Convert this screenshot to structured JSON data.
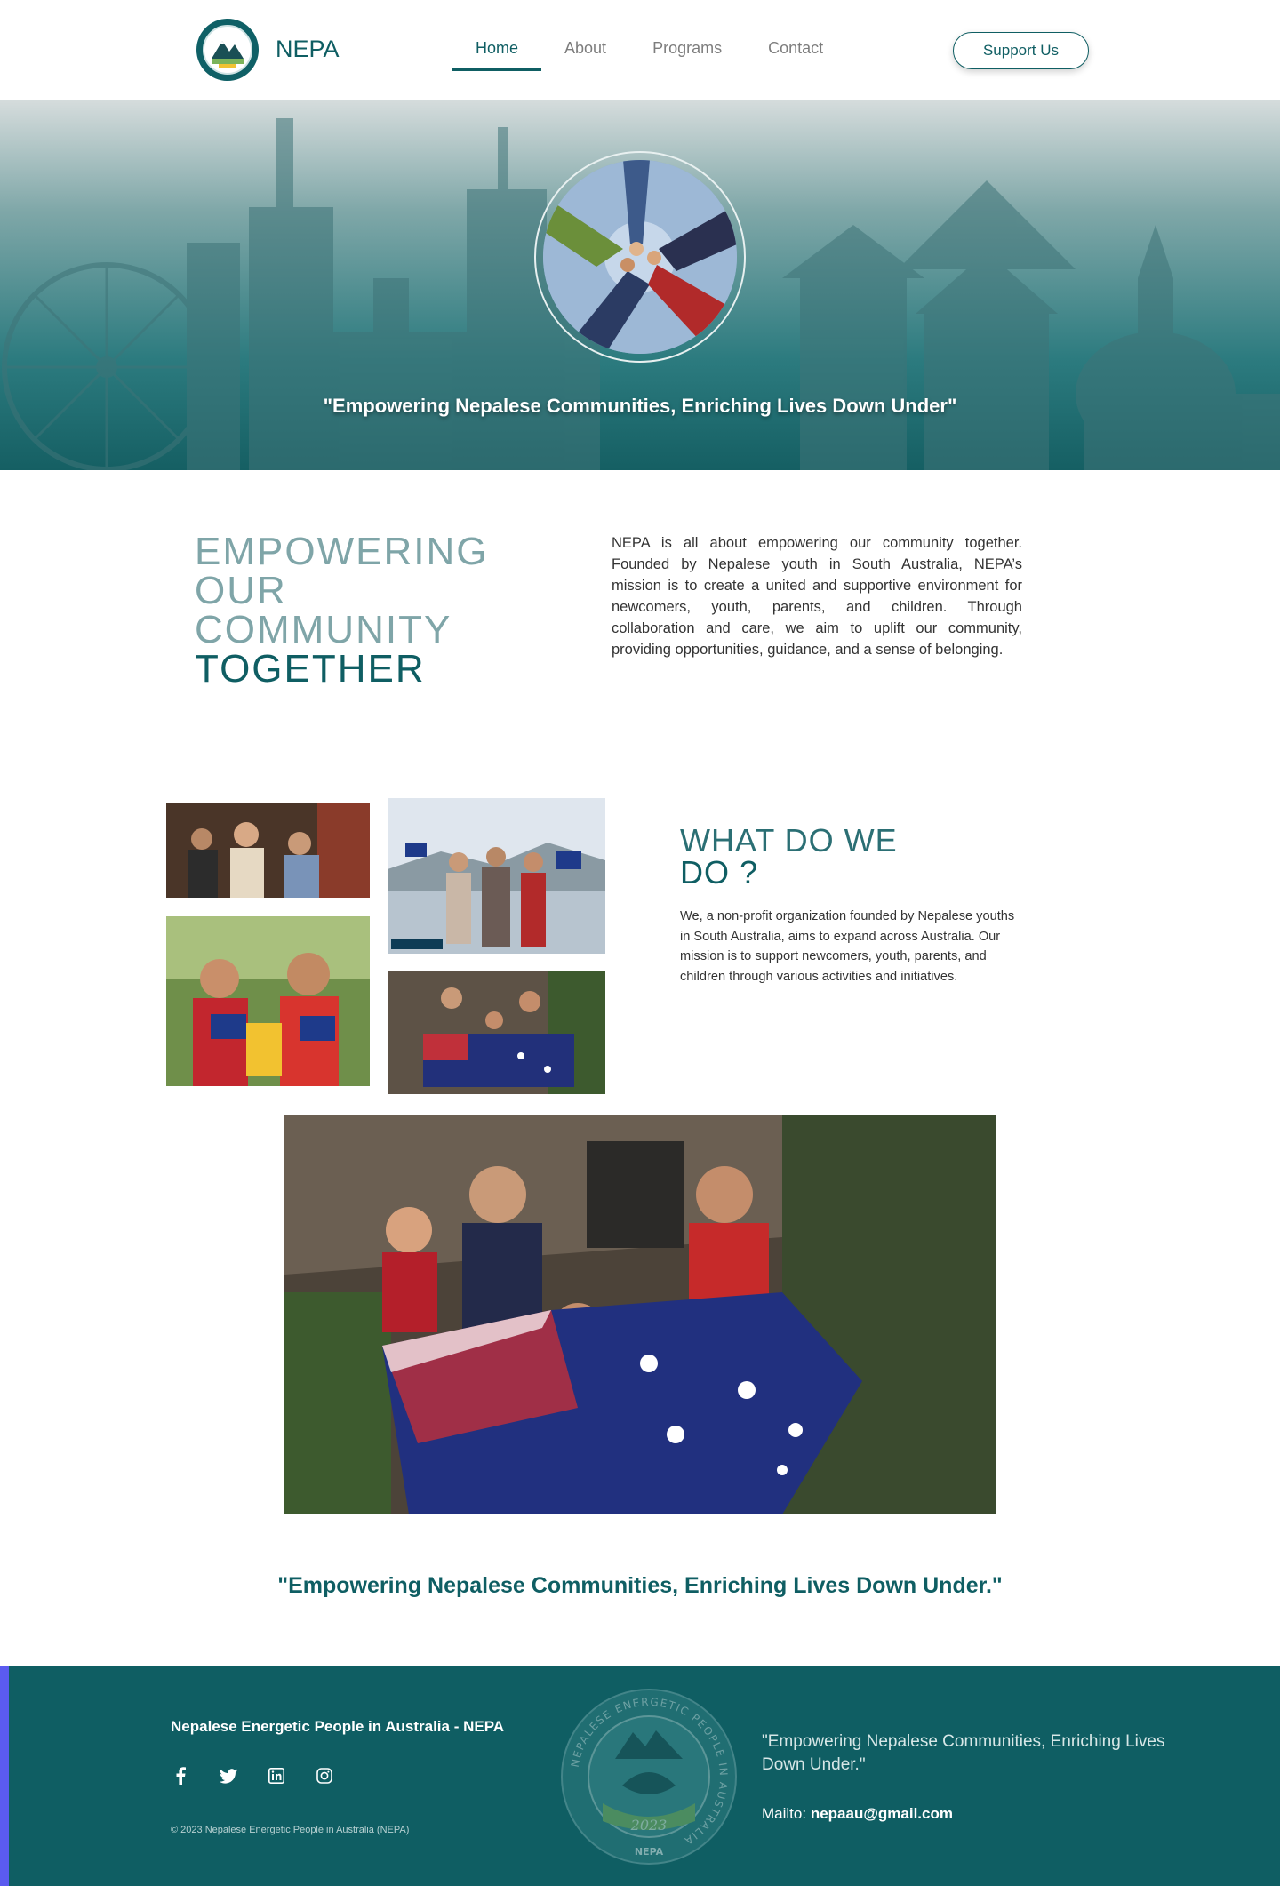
{
  "header": {
    "brand": "NEPA",
    "nav": [
      "Home",
      "About",
      "Programs",
      "Contact"
    ],
    "active_nav": "Home",
    "support_label": "Support Us"
  },
  "hero": {
    "quote": "\"Empowering Nepalese Communities, Enriching Lives Down Under\""
  },
  "intro": {
    "title_lines": [
      "EMPOWERING",
      "OUR",
      "COMMUNITY"
    ],
    "title_strong": "TOGETHER",
    "text": "NEPA is all about empowering our community together. Founded by Nepalese youth in South Australia, NEPA’s mission is to create a united and supportive environment for newcomers, youth, parents, and children. Through collaboration and care, we aim to uplift our community, providing opportunities, guidance, and a sense of belonging."
  },
  "what_we_do": {
    "title_light": "WHAT DO WE",
    "title_strong": "DO ?",
    "text": "We, a non-profit organization founded by Nepalese youths in South Australia, aims to expand across Australia. Our mission is to support newcomers, youth, parents, and children through various activities and initiatives."
  },
  "bottom_quote": "\"Empowering Nepalese Communities, Enriching Lives Down Under.\"",
  "footer": {
    "org_name": "Nepalese Energetic People in Australia - NEPA",
    "socials": [
      "facebook-icon",
      "twitter-icon",
      "linkedin-icon",
      "instagram-icon"
    ],
    "copyright": "© 2023 Nepalese Energetic People in Australia (NEPA)",
    "quote": "\"Empowering Nepalese Communities, Enriching Lives Down Under.\"",
    "mailto_label": "Mailto:",
    "email": "nepaau@gmail.com",
    "logo_year": "2023",
    "logo_ring_text": "NEPALESE ENERGETIC PEOPLE IN AUSTRALIA",
    "logo_tag": "NEPA"
  },
  "colors": {
    "primary": "#0f5e63",
    "footer_accent": "#5b5bf0"
  }
}
